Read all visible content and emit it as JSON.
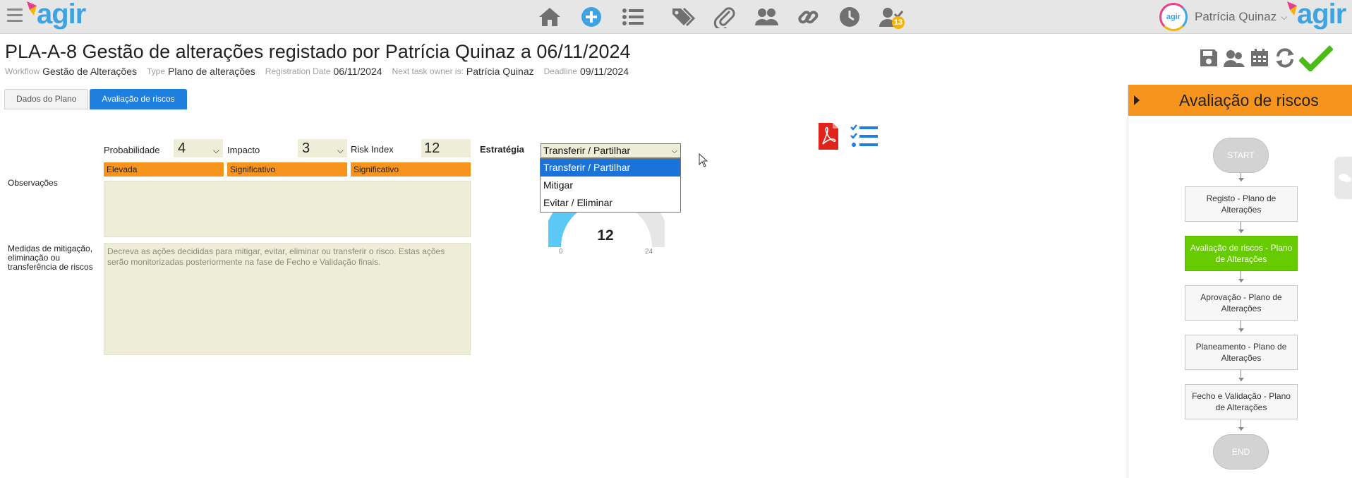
{
  "app": {
    "logo_text": "agir",
    "user_name": "Patrícia Quinaz",
    "avatar_text": "agir",
    "tasks_badge": "13"
  },
  "record": {
    "title": "PLA-A-8 Gestão de alterações registado por Patrícia Quinaz a 06/11/2024",
    "meta": [
      {
        "label": "Workflow",
        "value": "Gestão de Alterações"
      },
      {
        "label": "Type",
        "value": "Plano de alterações"
      },
      {
        "label": "Registration Date",
        "value": "06/11/2024"
      },
      {
        "label": "Next task owner is:",
        "value": "Patrícia Quinaz"
      },
      {
        "label": "Deadline",
        "value": "09/11/2024"
      }
    ]
  },
  "tabs": [
    {
      "label": "Dados do Plano",
      "active": false
    },
    {
      "label": "Avaliação de riscos",
      "active": true
    }
  ],
  "risk": {
    "probabilidade_label": "Probabilidade",
    "probabilidade_value": "4",
    "probabilidade_rating": "Elevada",
    "impacto_label": "Impacto",
    "impacto_value": "3",
    "impacto_rating": "Significativo",
    "risk_index_label": "Risk Index",
    "risk_index_value": "12",
    "risk_index_rating": "Significativo",
    "estrategia_label": "Estratégia",
    "estrategia_value": "Transferir / Partilhar",
    "estrategia_options": [
      "Transferir / Partilhar",
      "Mitigar",
      "Evitar / Eliminar"
    ],
    "observacoes_label": "Observações",
    "observacoes_value": "",
    "medidas_label": "Medidas de mitigação, eliminação ou transferência de riscos",
    "medidas_placeholder": "Decreva as ações decididas para mitigar, evitar, eliminar ou transferir o risco. Estas ações serão monitorizadas posteriormente na fase de Fecho e Validação finais.",
    "rating_color": "#f7941d"
  },
  "gauge": {
    "value": "12",
    "min": "0",
    "max": "24",
    "fill_color": "#5bc8f5",
    "track_color": "#e6e6e6"
  },
  "workflow_panel": {
    "title": "Avaliação de riscos",
    "start_label": "START",
    "end_label": "END",
    "steps": [
      {
        "label": "Registo - Plano de Alterações",
        "active": false
      },
      {
        "label": "Avaliação de riscos - Plano de Alterações",
        "active": true
      },
      {
        "label": "Aprovação - Plano de Alterações",
        "active": false
      },
      {
        "label": "Planeamento - Plano de Alterações",
        "active": false
      },
      {
        "label": "Fecho e Validação - Plano de Alterações",
        "active": false
      }
    ],
    "header_color": "#f7941d",
    "active_color": "#66cc00"
  },
  "icons": {
    "nav": [
      "home-icon",
      "add-icon",
      "list-icon",
      "tags-icon",
      "paperclip-icon",
      "users-icon",
      "link-icon",
      "clock-icon",
      "user-tasks-icon"
    ],
    "actions": [
      "save-icon",
      "participants-icon",
      "calendar-icon",
      "refresh-icon",
      "check-icon"
    ],
    "tools": [
      "pdf-icon",
      "checklist-icon"
    ]
  }
}
